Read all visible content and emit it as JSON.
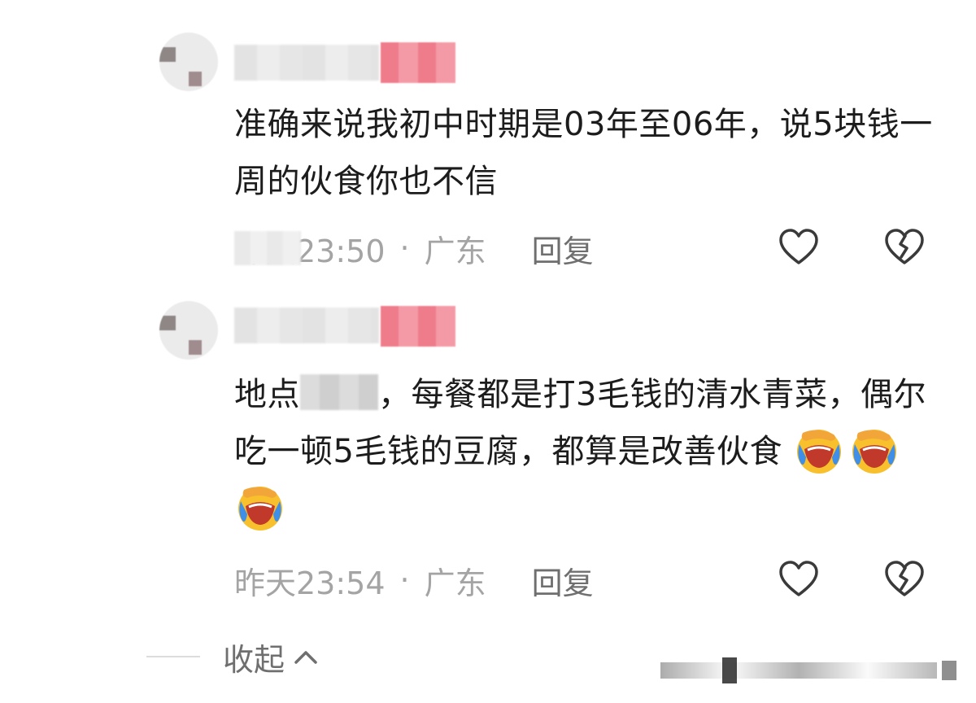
{
  "comments": [
    {
      "text": "准确来说我初中时期是03年至06年，说5块钱一周的伙食你也不信",
      "time": "昨天23:50",
      "location": "广东",
      "reply_label": "回复"
    },
    {
      "text_before": "地点",
      "text_after": "，每餐都是打3毛钱的清水青菜，偶尔吃一顿5毛钱的豆腐，都算是改善伙食",
      "emojis": [
        "crying-laughing-emoji",
        "crying-laughing-emoji",
        "crying-laughing-emoji"
      ],
      "time": "昨天23:54",
      "location": "广东",
      "reply_label": "回复"
    }
  ],
  "collapse_label": "收起",
  "icons": {
    "like": "heart-outline-icon",
    "dislike": "broken-heart-icon",
    "collapse": "chevron-up-icon"
  },
  "colors": {
    "text": "#1c1c1c",
    "meta": "#a4a4a4",
    "reply": "#6f6f6f",
    "tag": "#ef7c8b"
  }
}
